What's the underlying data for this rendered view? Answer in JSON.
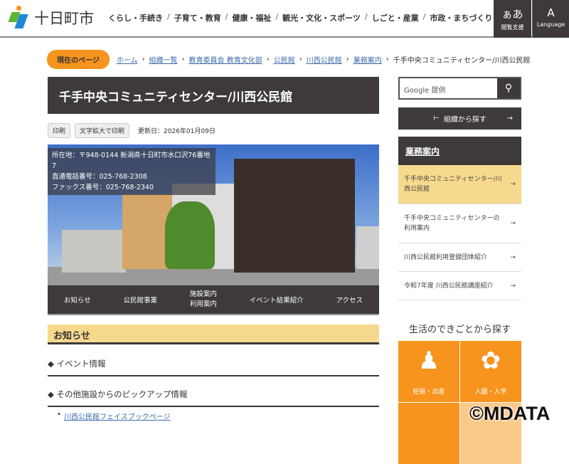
{
  "header": {
    "site_name": "十日町市",
    "nav": [
      "くらし・手続き",
      "子育て・教育",
      "健康・福祉",
      "観光・文化・スポーツ",
      "しごと・産業",
      "市政・まちづくり"
    ],
    "accessibility": {
      "glyph": "ぁあ",
      "label": "閲覧支援"
    },
    "language": {
      "glyph": "A",
      "label": "Language"
    }
  },
  "breadcrumb": {
    "current_label": "現在のページ",
    "links": [
      "ホーム",
      "組織一覧",
      "教育委員会 教育文化部",
      "公民館",
      "川西公民館",
      "業務案内"
    ],
    "current": "千手中央コミュニティセンター/川西公民館"
  },
  "page": {
    "title": "千手中央コミュニティセンター/川西公民館",
    "print": "印刷",
    "print_large": "文字拡大で印刷",
    "updated": "更新日：2026年01月09日",
    "info": [
      "所在地：〒948-0144 新潟県十日町市水口沢76番地7",
      "直通電話番号：025-768-2308",
      "ファックス番号：025-768-2340"
    ],
    "nav": [
      "お知らせ",
      "公民館事業",
      "施設案内\n利用案内",
      "イベント結果紹介",
      "アクセス"
    ],
    "notice": "お知らせ",
    "sections": [
      "イベント情報",
      "その他施設からのピックアップ情報"
    ],
    "link": "川西公民館フェイスブックページ"
  },
  "sidebar": {
    "search_placeholder": "Google 提供",
    "org_button": "組織から探す",
    "menu_title": "業務案内",
    "items": [
      "千手中央コミュニティセンター/川西公民館",
      "千手中央コミュニティセンターの利用案内",
      "川西公民館利用登録団体紹介",
      "令和7年度 川西公民館講座紹介"
    ],
    "life_title": "生活のできごとから探す",
    "tiles": [
      "妊娠・出産",
      "入園・入学"
    ]
  },
  "watermark": "©MDATA"
}
